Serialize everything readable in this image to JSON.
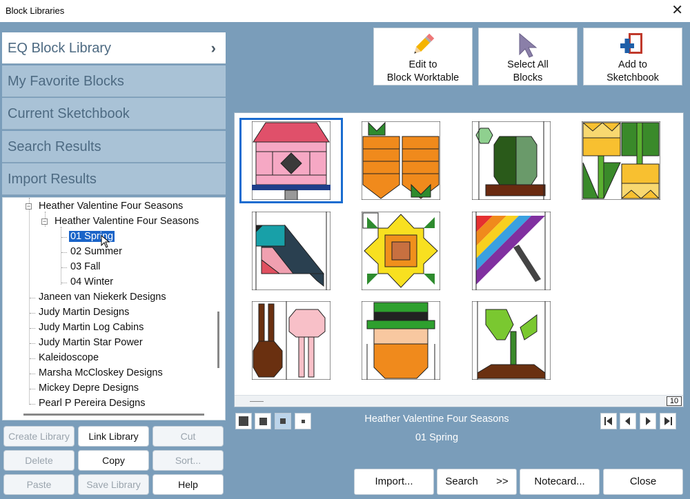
{
  "window": {
    "title": "Block Libraries",
    "close_icon": "close-icon"
  },
  "library_tabs": [
    {
      "label": "EQ Block Library",
      "active": true
    },
    {
      "label": "My Favorite Blocks"
    },
    {
      "label": "Current Sketchbook"
    },
    {
      "label": "Search Results"
    },
    {
      "label": "Import Results"
    }
  ],
  "tree": {
    "items": [
      {
        "label": "Heather Valentine Four Seasons"
      },
      {
        "label": "Heather Valentine Four Seasons"
      },
      {
        "label": "01 Spring",
        "selected": true
      },
      {
        "label": "02 Summer"
      },
      {
        "label": "03 Fall"
      },
      {
        "label": "04 Winter"
      },
      {
        "label": "Janeen van Niekerk Designs"
      },
      {
        "label": "Judy Martin Designs"
      },
      {
        "label": "Judy Martin Log Cabins"
      },
      {
        "label": "Judy Martin Star Power"
      },
      {
        "label": "Kaleidoscope"
      },
      {
        "label": "Marsha McCloskey Designs"
      },
      {
        "label": "Mickey Depre Designs"
      },
      {
        "label": "Pearl P Pereira Designs"
      }
    ]
  },
  "library_buttons": {
    "create": "Create Library",
    "link": "Link Library",
    "cut": "Cut",
    "delete": "Delete",
    "copy": "Copy",
    "sort": "Sort...",
    "paste": "Paste",
    "save": "Save Library",
    "help": "Help"
  },
  "toolbar": {
    "edit_line1": "Edit to",
    "edit_line2": "Block Worktable",
    "select_line1": "Select All",
    "select_line2": "Blocks",
    "add_line1": "Add to",
    "add_line2": "Sketchbook"
  },
  "blocks": [
    {
      "name": "birdhouse"
    },
    {
      "name": "carrots"
    },
    {
      "name": "cactus"
    },
    {
      "name": "tulips"
    },
    {
      "name": "bird"
    },
    {
      "name": "sunflower"
    },
    {
      "name": "rainbow-kite"
    },
    {
      "name": "bunny"
    },
    {
      "name": "leprechaun"
    },
    {
      "name": "sprout"
    }
  ],
  "grid": {
    "count": "10"
  },
  "breadcrumb": {
    "library": "Heather Valentine Four Seasons",
    "section": "01 Spring"
  },
  "bottom_buttons": {
    "import": "Import...",
    "search": "Search",
    "search_arrows": ">>",
    "notecard": "Notecard...",
    "close": "Close"
  },
  "colors": {
    "selection": "#1a6cd0",
    "accent_bg": "#7a9dba",
    "tab_bg": "#a9c2d6"
  }
}
